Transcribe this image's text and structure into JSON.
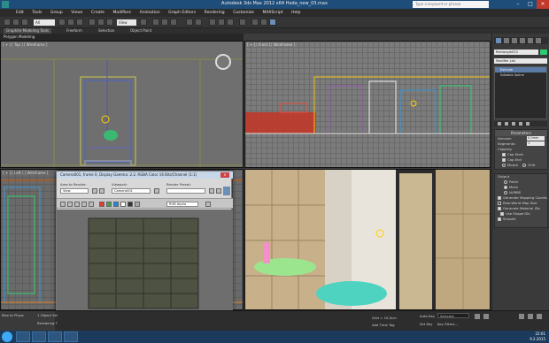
{
  "window": {
    "title": "Autodesk 3ds Max  2012 x64      Hodа_new_03.max",
    "search_placeholder": "Type a keyword or phrase"
  },
  "menu": [
    "Edit",
    "Tools",
    "Group",
    "Views",
    "Create",
    "Modifiers",
    "Animation",
    "Graph Editors",
    "Rendering",
    "Customize",
    "MAXScript",
    "Help"
  ],
  "toolbar": {
    "selection_filter": "All",
    "view_dropdown": "View"
  },
  "ribbon": {
    "tabs": [
      "Graphite Modeling Tools",
      "Freeform",
      "Selection",
      "Object Paint"
    ],
    "sub": "Polygon Modeling"
  },
  "viewports": {
    "top": "[ + ] [ Top ] [ Wireframe ]",
    "front": "[ + ] [ Front ] [ Wireframe ]",
    "left": "[ + ] [ Left ] [ Wireframe ]",
    "camera": "[ + ] [ Camera001 ] [ Realistic ]"
  },
  "command_panel": {
    "object_name": "Rectangle023",
    "modifier_list": "Modifier List",
    "stack": [
      "Extrude",
      "Editable Spline"
    ],
    "parameters_title": "Parameters",
    "amount_label": "Amount:",
    "amount_value": "0,0mm",
    "segments_label": "Segments:",
    "segments_value": "1",
    "capping_label": "Capping",
    "cap_start": "Cap Start",
    "cap_end": "Cap End",
    "morph": "Morph",
    "grid": "Grid",
    "output_label": "Output",
    "patch": "Patch",
    "mesh": "Mesh",
    "nurbs": "NURBS",
    "gen_mapping": "Generate Mapping Coords.",
    "real_world": "Real-World Map Size",
    "gen_material": "Generate Material IDs",
    "use_shape": "Use Shape IDs",
    "smooth": "Smooth"
  },
  "frame_buffer": {
    "title": "Camera001, frame 0, Display Gamma: 2.2, RGBA Color 16 Bits/Channel (1:1)",
    "area_label": "Area to Render:",
    "area_value": "View",
    "viewport_label": "Viewport:",
    "viewport_value": "Camera001",
    "preset_label": "Render Preset:",
    "preset_value": "",
    "channel_value": "RGB Alpha",
    "image_precision_label": "Image Precision (Antialiasing):",
    "image_precision_value": "Medium: Min 1/4, Max 4",
    "soft_shadows_label": "Soft Shadows Precision:",
    "soft_shadows_value": "1 - Default",
    "final_gather_label": "Final Gather Precision:",
    "final_gather_value": "Draft",
    "reuse_label": "Reuse:",
    "geometry_label": "Geometry"
  },
  "status": {
    "objects": "1 Object Sel",
    "rendering": "Rendering T",
    "grid": "Grid = 10,0cm",
    "auto_key": "Auto Key",
    "selected": "Selected",
    "set_key": "Set Key",
    "key_filters": "Key Filters...",
    "add_time_tag": "Add Time Tag",
    "maxscript": "Max to Physc"
  },
  "clock": {
    "time": "22:01",
    "date": "9.2.2015"
  }
}
